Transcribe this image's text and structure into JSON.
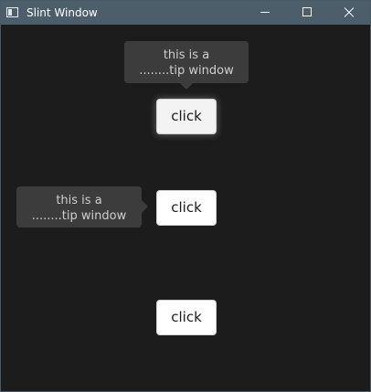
{
  "window": {
    "title": "Slint Window",
    "title_bar_color": "#4d5e6b",
    "background_color": "#1c1c1c"
  },
  "title_bar_icons": {
    "app": "app-window-icon",
    "minimize": "minimize-icon",
    "maximize": "maximize-icon",
    "close": "close-icon"
  },
  "buttons": [
    {
      "label": "click"
    },
    {
      "label": "click"
    },
    {
      "label": "click"
    }
  ],
  "tooltips": [
    {
      "line1": "this is a",
      "line2": "........tip window",
      "pointer": "down"
    },
    {
      "line1": "this is a",
      "line2": "........tip window",
      "pointer": "right"
    }
  ]
}
